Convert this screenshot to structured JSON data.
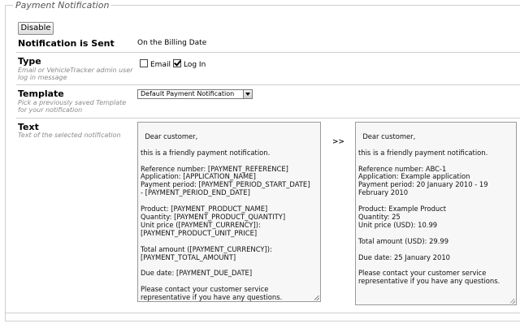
{
  "fieldset": {
    "legend": "Payment Notification"
  },
  "actions": {
    "disable_label": "Disable"
  },
  "notification_sent": {
    "label": "Notification is Sent",
    "value": "On the Billing Date"
  },
  "type": {
    "label": "Type",
    "hint": "Email or VehicleTracker admin user log in message",
    "options": [
      {
        "label": "Email",
        "checked": false
      },
      {
        "label": "Log In",
        "checked": true
      }
    ]
  },
  "template": {
    "label": "Template",
    "hint": "Pick a previously saved Template for your notification",
    "selected": "Default Payment Notification"
  },
  "text": {
    "label": "Text",
    "hint": "Text of the selected notification",
    "arrow": ">>",
    "source": "Dear customer,\n\nthis is a friendly payment notification.\n\nReference number: [PAYMENT_REFERENCE]\nApplication: [APPLICATION_NAME]\nPayment period: [PAYMENT_PERIOD_START_DATE]\n- [PAYMENT_PERIOD_END_DATE]\n\nProduct: [PAYMENT_PRODUCT_NAME]\nQuantity: [PAYMENT_PRODUCT_QUANTITY]\nUnit price ([PAYMENT_CURRENCY]):\n[PAYMENT_PRODUCT_UNIT_PRICE]\n\nTotal amount ([PAYMENT_CURRENCY]):\n[PAYMENT_TOTAL_AMOUNT]\n\nDue date: [PAYMENT_DUE_DATE]\n\nPlease contact your customer service\nrepresentative if you have any questions.",
    "preview": "Dear customer,\n\nthis is a friendly payment notification.\n\nReference number: ABC-1\nApplication: Example application\nPayment period: 20 January 2010 - 19\nFebruary 2010\n\nProduct: Example Product\nQuantity: 25\nUnit price (USD): 10.99\n\nTotal amount (USD): 29.99\n\nDue date: 25 January 2010\n\nPlease contact your customer service\nrepresentative if you have any questions."
  }
}
